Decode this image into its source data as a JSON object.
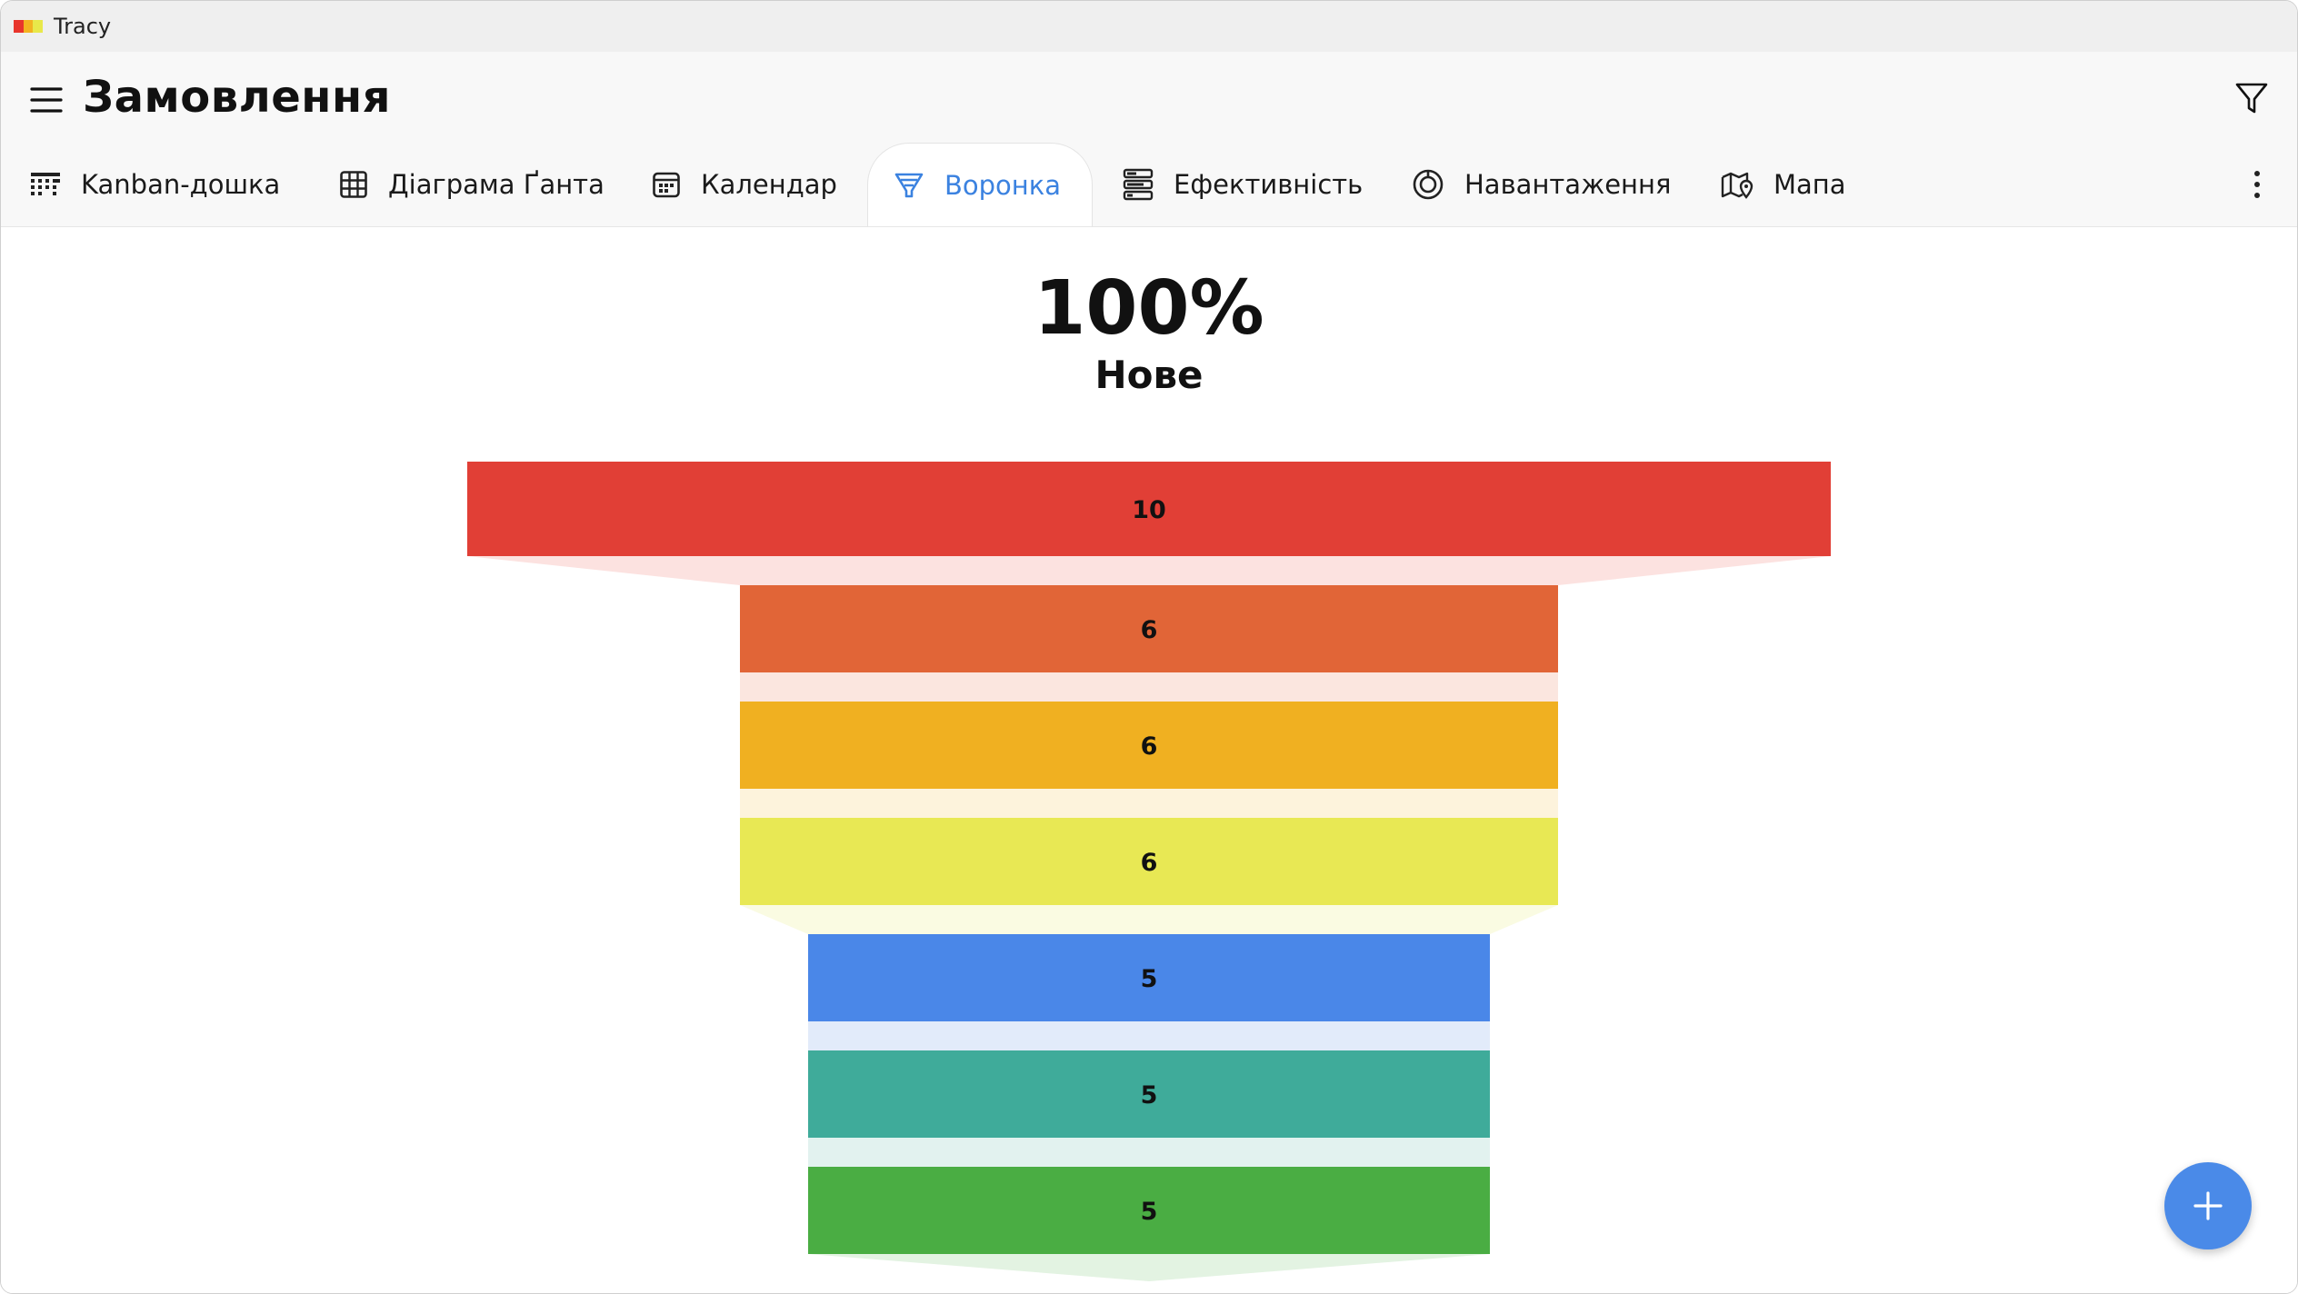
{
  "app": {
    "title": "Tracy",
    "logo_colors": [
      "#e8352c",
      "#f3b320",
      "#e8e84a"
    ]
  },
  "header": {
    "title": "Замовлення",
    "menu_icon": "hamburger-menu-icon",
    "filter_icon": "filter-icon",
    "more_icon": "more-vertical-icon"
  },
  "tabs": [
    {
      "label": "Kanban-дошка",
      "icon": "kanban-board-icon",
      "active": false
    },
    {
      "label": "Діаграма Ґанта",
      "icon": "gantt-grid-icon",
      "active": false
    },
    {
      "label": "Календар",
      "icon": "calendar-icon",
      "active": false
    },
    {
      "label": "Воронка",
      "icon": "funnel-icon",
      "active": true
    },
    {
      "label": "Ефективність",
      "icon": "efficiency-icon",
      "active": false
    },
    {
      "label": "Навантаження",
      "icon": "workload-icon",
      "active": false
    },
    {
      "label": "Мапа",
      "icon": "map-pin-icon",
      "active": false
    }
  ],
  "accent_color": "#3b82e0",
  "funnel": {
    "percent": "100%",
    "stage": "Нове"
  },
  "chart_data": {
    "type": "funnel",
    "values": [
      10,
      6,
      6,
      6,
      5,
      5,
      5
    ],
    "colors": [
      "#e13f36",
      "#e16537",
      "#f0b021",
      "#e8e854",
      "#4a87e8",
      "#3fab9a",
      "#4aad43"
    ],
    "connector_colors": [
      "#fce2e0",
      "#fbe6df",
      "#fdf3dc",
      "#fafbe2",
      "#e2ebfa",
      "#e2f2ef",
      "#e3f3e2"
    ]
  },
  "fab": {
    "icon": "plus-icon"
  }
}
